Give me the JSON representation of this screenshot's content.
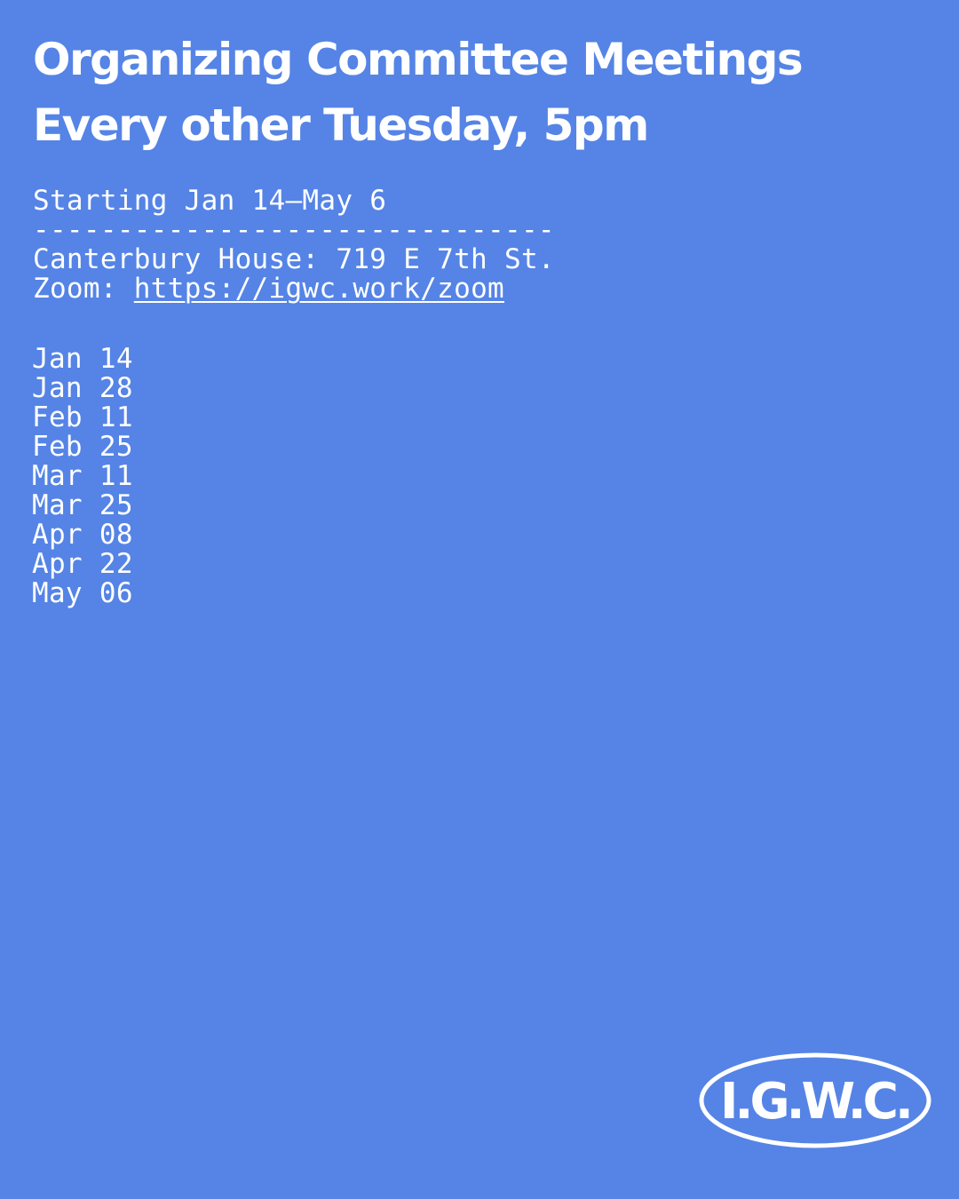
{
  "heading": {
    "line1": "Organizing Committee Meetings",
    "line2": "Every other Tuesday, 5pm"
  },
  "info": {
    "starting": "Starting Jan 14–May 6",
    "divider": "-------------------------------",
    "location": "Canterbury House: 719 E 7th St.",
    "zoom_label": "Zoom: ",
    "zoom_link": "https://igwc.work/zoom"
  },
  "dates": [
    "Jan 14",
    "Jan 28",
    "Feb 11",
    "Feb 25",
    "Mar 11",
    "Mar 25",
    "Apr 08",
    "Apr 22",
    "May 06"
  ],
  "logo": {
    "text": "I.G.W.C."
  },
  "colors": {
    "background": "#5584e6",
    "text": "#ffffff"
  }
}
